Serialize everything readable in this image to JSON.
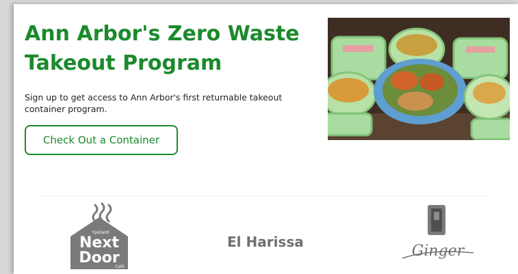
{
  "hero": {
    "title": "Ann Arbor's Zero Waste Takeout Program",
    "subtitle": "Sign up to get access to Ann Arbor's first returnable takeout container program.",
    "cta_label": "Check Out a Container"
  },
  "partners": [
    {
      "name": "Next Door",
      "logo_text_top": "Next",
      "logo_text_bottom": "Door",
      "logo_small_top": "Ypsilanti",
      "logo_small_bottom": "Café"
    },
    {
      "name": "El Harissa"
    },
    {
      "name": "Ginger",
      "logo_script": "Ginger"
    }
  ],
  "colors": {
    "brand_green": "#1c8a2c",
    "logo_gray": "#6f6f6f",
    "photo_container_green": "#a9dca0",
    "photo_plate_blue": "#5f9ed0"
  },
  "icons": [
    "steam-icon",
    "house-icon",
    "playing-card-icon"
  ]
}
